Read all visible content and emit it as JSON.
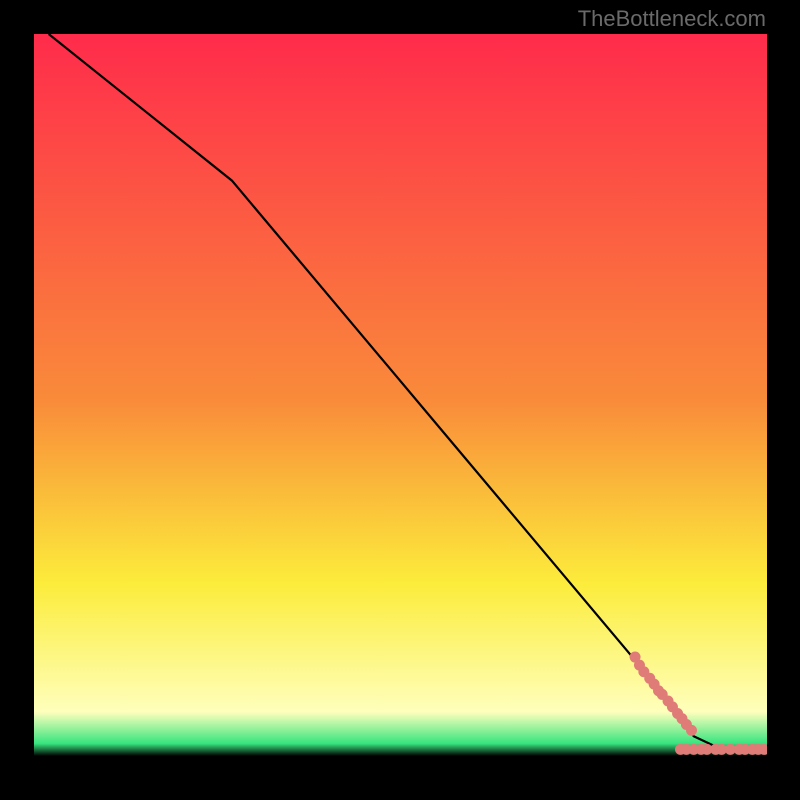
{
  "watermark": "TheBottleneck.com",
  "colors": {
    "red": "#ff2b4b",
    "orange": "#f98b3a",
    "yellow": "#fcec3b",
    "paleyellow": "#feffbc",
    "green": "#37e57f",
    "black": "#000000",
    "marker": "#e07c78"
  },
  "chart_data": {
    "type": "line",
    "title": "",
    "xlabel": "",
    "ylabel": "",
    "xlim": [
      0,
      100
    ],
    "ylim": [
      0,
      100
    ],
    "curve": [
      {
        "x": 2,
        "y": 100
      },
      {
        "x": 27,
        "y": 80
      },
      {
        "x": 85,
        "y": 11
      },
      {
        "x": 90,
        "y": 4.2
      },
      {
        "x": 94,
        "y": 2.3
      },
      {
        "x": 100,
        "y": 2.0
      }
    ],
    "markers": [
      {
        "x": 82,
        "y": 15
      },
      {
        "x": 82.6,
        "y": 13.9
      },
      {
        "x": 83.2,
        "y": 13.0
      },
      {
        "x": 84.0,
        "y": 12.1
      },
      {
        "x": 84.6,
        "y": 11.3
      },
      {
        "x": 85.2,
        "y": 10.4
      },
      {
        "x": 85.7,
        "y": 9.9
      },
      {
        "x": 86.5,
        "y": 9.0
      },
      {
        "x": 87.1,
        "y": 8.2
      },
      {
        "x": 87.8,
        "y": 7.3
      },
      {
        "x": 88.4,
        "y": 6.6
      },
      {
        "x": 89.0,
        "y": 5.8
      },
      {
        "x": 89.7,
        "y": 5.0
      },
      {
        "x": 88.2,
        "y": 2.4
      },
      {
        "x": 89.0,
        "y": 2.4
      },
      {
        "x": 90.0,
        "y": 2.4
      },
      {
        "x": 91.0,
        "y": 2.4
      },
      {
        "x": 91.8,
        "y": 2.4
      },
      {
        "x": 93.0,
        "y": 2.4
      },
      {
        "x": 93.8,
        "y": 2.4
      },
      {
        "x": 95.0,
        "y": 2.4
      },
      {
        "x": 96.2,
        "y": 2.4
      },
      {
        "x": 97.0,
        "y": 2.4
      },
      {
        "x": 98.0,
        "y": 2.4
      },
      {
        "x": 98.8,
        "y": 2.4
      },
      {
        "x": 99.6,
        "y": 2.4
      }
    ],
    "gradient_stops": [
      {
        "offset": 0.0,
        "key": "red"
      },
      {
        "offset": 0.5,
        "key": "orange"
      },
      {
        "offset": 0.75,
        "key": "yellow"
      },
      {
        "offset": 0.925,
        "key": "paleyellow"
      },
      {
        "offset": 0.968,
        "key": "green"
      },
      {
        "offset": 0.985,
        "key": "black"
      }
    ]
  }
}
